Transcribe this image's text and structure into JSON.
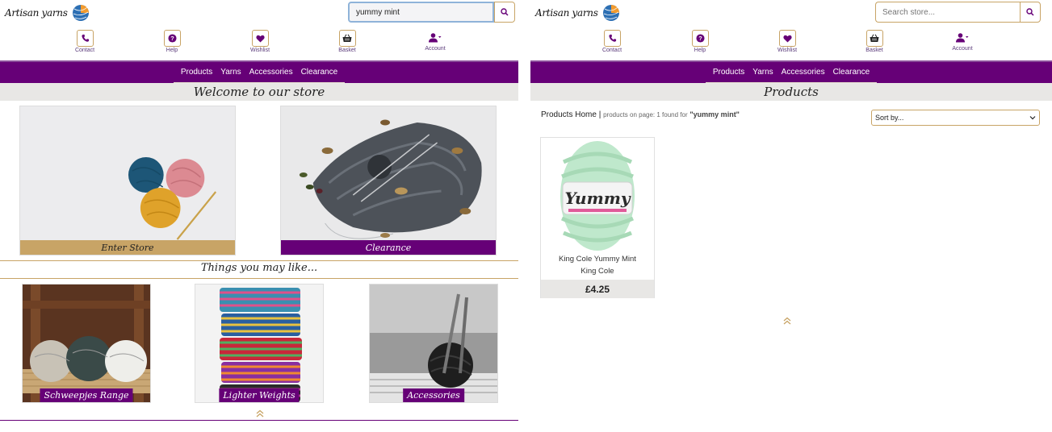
{
  "left": {
    "logo_text": "Artisan yarns",
    "search": {
      "value": "yummy mint",
      "placeholder": ""
    },
    "icons": [
      {
        "label": "Contact",
        "icon": "phone-icon"
      },
      {
        "label": "Help",
        "icon": "help-icon"
      },
      {
        "label": "Wishlist",
        "icon": "heart-icon"
      },
      {
        "label": "Basket",
        "icon": "basket-icon"
      },
      {
        "label": "Account",
        "icon": "account-icon"
      }
    ],
    "nav": [
      "Products",
      "Yarns",
      "Accessories",
      "Clearance"
    ],
    "page_title": "Welcome to our store",
    "heroes": [
      {
        "label": "Enter Store"
      },
      {
        "label": "Clearance"
      }
    ],
    "section_title": "Things you may like...",
    "thumbs": [
      {
        "label": "Schweepjes Range"
      },
      {
        "label": "Lighter Weights"
      },
      {
        "label": "Accessories"
      }
    ]
  },
  "right": {
    "logo_text": "Artisan yarns",
    "search": {
      "value": "",
      "placeholder": "Search store..."
    },
    "icons": [
      {
        "label": "Contact",
        "icon": "phone-icon"
      },
      {
        "label": "Help",
        "icon": "help-icon"
      },
      {
        "label": "Wishlist",
        "icon": "heart-icon"
      },
      {
        "label": "Basket",
        "icon": "basket-icon"
      },
      {
        "label": "Account",
        "icon": "account-icon"
      }
    ],
    "nav": [
      "Products",
      "Yarns",
      "Accessories",
      "Clearance"
    ],
    "page_title": "Products",
    "breadcrumb": {
      "home": "Products Home",
      "separator": "|",
      "count_text": "products on page: 1 found for",
      "query": "\"yummy mint\""
    },
    "sort": {
      "selected": "Sort by..."
    },
    "product": {
      "name": "King Cole Yummy Mint",
      "brand": "King Cole",
      "price": "£4.25",
      "label_text": "Yummy"
    }
  },
  "colors": {
    "brand_purple": "#660077",
    "gold": "#c8a466",
    "title_bar": "#e8e7e5"
  }
}
